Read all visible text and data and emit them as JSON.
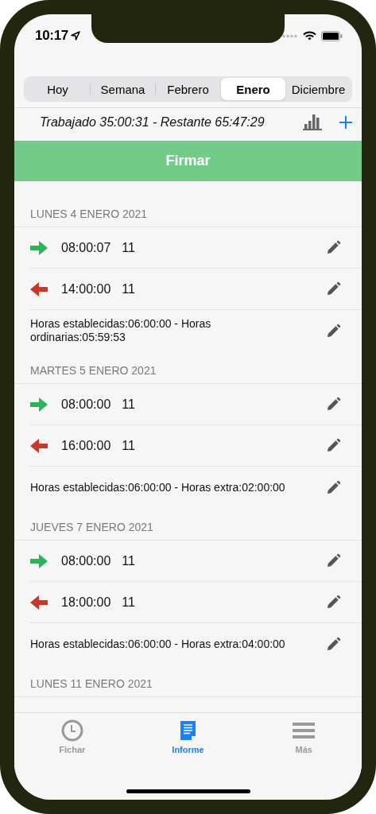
{
  "status_bar": {
    "time": "10:17"
  },
  "segments": [
    {
      "label": "Hoy",
      "selected": false
    },
    {
      "label": "Semana",
      "selected": false
    },
    {
      "label": "Febrero",
      "selected": false
    },
    {
      "label": "Enero",
      "selected": true
    },
    {
      "label": "Diciembre",
      "selected": false
    }
  ],
  "summary": "Trabajado 35:00:31 - Restante 65:47:29",
  "sign_button": "Firmar",
  "days": [
    {
      "header": "LUNES 4 ENERO 2021",
      "rows": [
        {
          "kind": "in",
          "time": "08:00:07",
          "code": "11"
        },
        {
          "kind": "out",
          "time": "14:00:00",
          "code": "11"
        },
        {
          "kind": "note",
          "text": "Horas establecidas:06:00:00 - Horas ordinarias:05:59:53"
        }
      ]
    },
    {
      "header": "MARTES 5 ENERO 2021",
      "rows": [
        {
          "kind": "in",
          "time": "08:00:00",
          "code": "11"
        },
        {
          "kind": "out",
          "time": "16:00:00",
          "code": "11"
        },
        {
          "kind": "note",
          "text": "Horas establecidas:06:00:00 - Horas extra:02:00:00"
        }
      ]
    },
    {
      "header": "JUEVES 7 ENERO 2021",
      "rows": [
        {
          "kind": "in",
          "time": "08:00:00",
          "code": "11"
        },
        {
          "kind": "out",
          "time": "18:00:00",
          "code": "11"
        },
        {
          "kind": "note",
          "text": "Horas establecidas:06:00:00 - Horas extra:04:00:00"
        }
      ]
    },
    {
      "header": "LUNES 11 ENERO 2021"
    }
  ],
  "tabs": [
    {
      "kind": "clock",
      "label": "Fichar",
      "selected": false
    },
    {
      "kind": "document",
      "label": "Informe",
      "selected": true
    },
    {
      "kind": "menu",
      "label": "Más",
      "selected": false
    }
  ]
}
